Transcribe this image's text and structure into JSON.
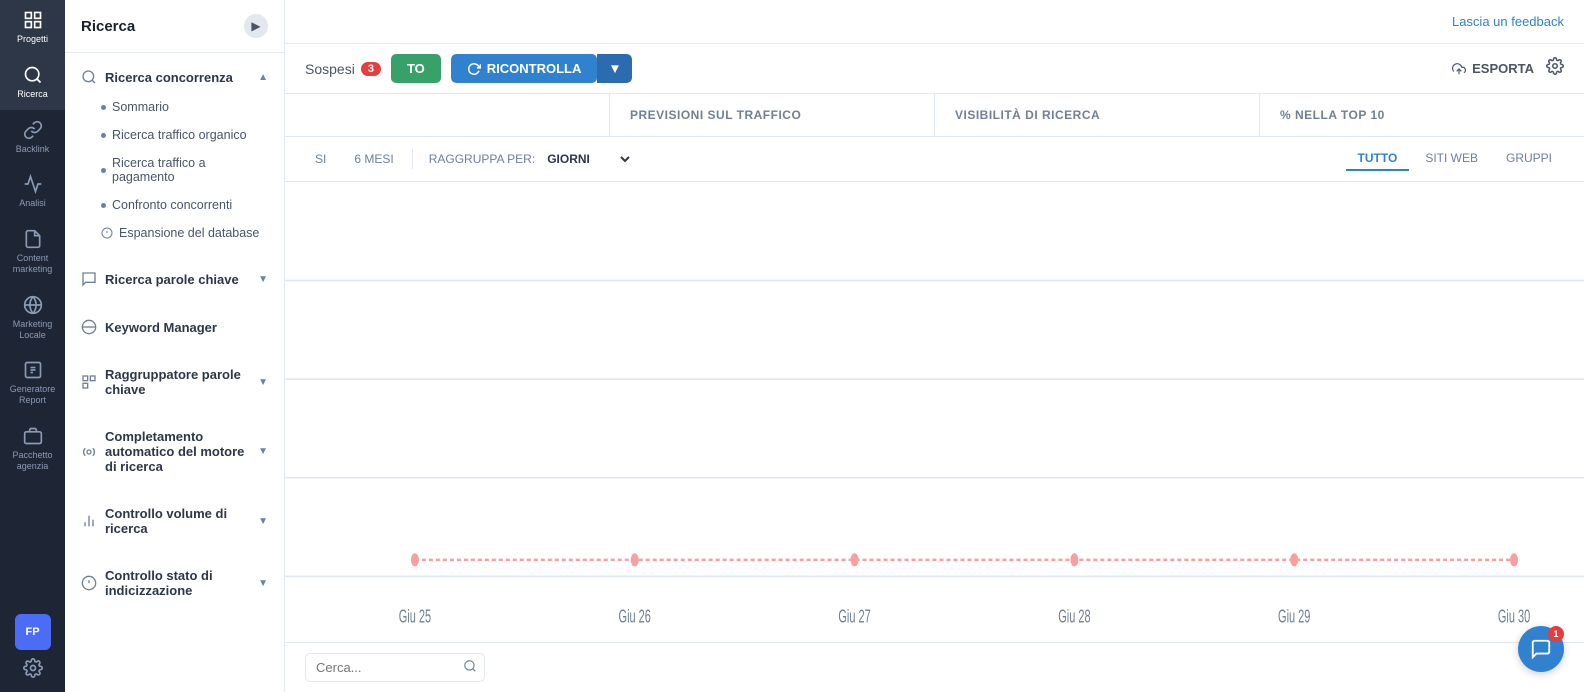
{
  "app": {
    "feedback_link": "Lascia un feedback"
  },
  "icon_sidebar": {
    "items": [
      {
        "id": "progetti",
        "label": "Progetti",
        "active": false
      },
      {
        "id": "ricerca",
        "label": "Ricerca",
        "active": true
      },
      {
        "id": "backlink",
        "label": "Backlink",
        "active": false
      },
      {
        "id": "analisi",
        "label": "Analisi",
        "active": false
      },
      {
        "id": "content-marketing",
        "label": "Content marketing",
        "active": false
      },
      {
        "id": "marketing-locale",
        "label": "Marketing Locale",
        "active": false
      },
      {
        "id": "generatore-report",
        "label": "Generatore Report",
        "active": false
      },
      {
        "id": "pacchetto-agenzia",
        "label": "Pacchetto agenzia",
        "active": false
      }
    ],
    "avatar": "FP"
  },
  "nav_sidebar": {
    "title": "Ricerca",
    "toggle_title": "Comprimi menu",
    "sections": [
      {
        "id": "ricerca-concorrenza",
        "label": "Ricerca concorrenza",
        "expanded": true,
        "items": [
          {
            "id": "sommario",
            "label": "Sommario"
          },
          {
            "id": "traffico-organico",
            "label": "Ricerca traffico organico"
          },
          {
            "id": "traffico-pagamento",
            "label": "Ricerca traffico a pagamento"
          },
          {
            "id": "confronto-concorrenti",
            "label": "Confronto concorrenti"
          },
          {
            "id": "espansione-database",
            "label": "Espansione del database"
          }
        ]
      },
      {
        "id": "ricerca-parole-chiave",
        "label": "Ricerca parole chiave",
        "expanded": false,
        "items": []
      },
      {
        "id": "keyword-manager",
        "label": "Keyword Manager",
        "expanded": false,
        "items": []
      },
      {
        "id": "raggruppatore-parole-chiave",
        "label": "Raggruppatore parole chiave",
        "expanded": false,
        "items": []
      },
      {
        "id": "completamento-automatico",
        "label": "Completamento automatico del motore di ricerca",
        "expanded": false,
        "items": []
      },
      {
        "id": "controllo-volume",
        "label": "Controllo volume di ricerca",
        "expanded": false,
        "items": []
      },
      {
        "id": "controllo-indicizzazione",
        "label": "Controllo stato di indicizzazione",
        "expanded": false,
        "items": []
      }
    ]
  },
  "action_bar": {
    "sospesi_label": "Sospesi",
    "sospesi_count": "3",
    "btn_green_label": "TO",
    "btn_ricontrolla_label": "RICONTROLLA",
    "esporta_label": "ESPORTA"
  },
  "metrics": {
    "col1": "",
    "col2": "PREVISIONI SUL TRAFFICO",
    "col3": "VISIBILITÀ DI RICERCA",
    "col4": "% NELLA TOP 10"
  },
  "chart_controls": {
    "time_options": [
      "SI",
      "6 MESI"
    ],
    "raggruppa_label": "RAGGRUPPA PER:",
    "raggruppa_value": "GIORNI",
    "view_tabs": [
      {
        "id": "tutto",
        "label": "TUTTO",
        "active": true
      },
      {
        "id": "siti-web",
        "label": "SITI WEB",
        "active": false
      },
      {
        "id": "gruppi",
        "label": "GRUPPI",
        "active": false
      }
    ]
  },
  "chart": {
    "x_labels": [
      "Giu 25",
      "Giu 26",
      "Giu 27",
      "Giu 28",
      "Giu 29",
      "Giu 30"
    ],
    "dot_color": "#f6a0a0",
    "line_color": "#f6a0a0"
  },
  "search": {
    "placeholder": "Cerca..."
  },
  "chat": {
    "badge_count": "1"
  }
}
